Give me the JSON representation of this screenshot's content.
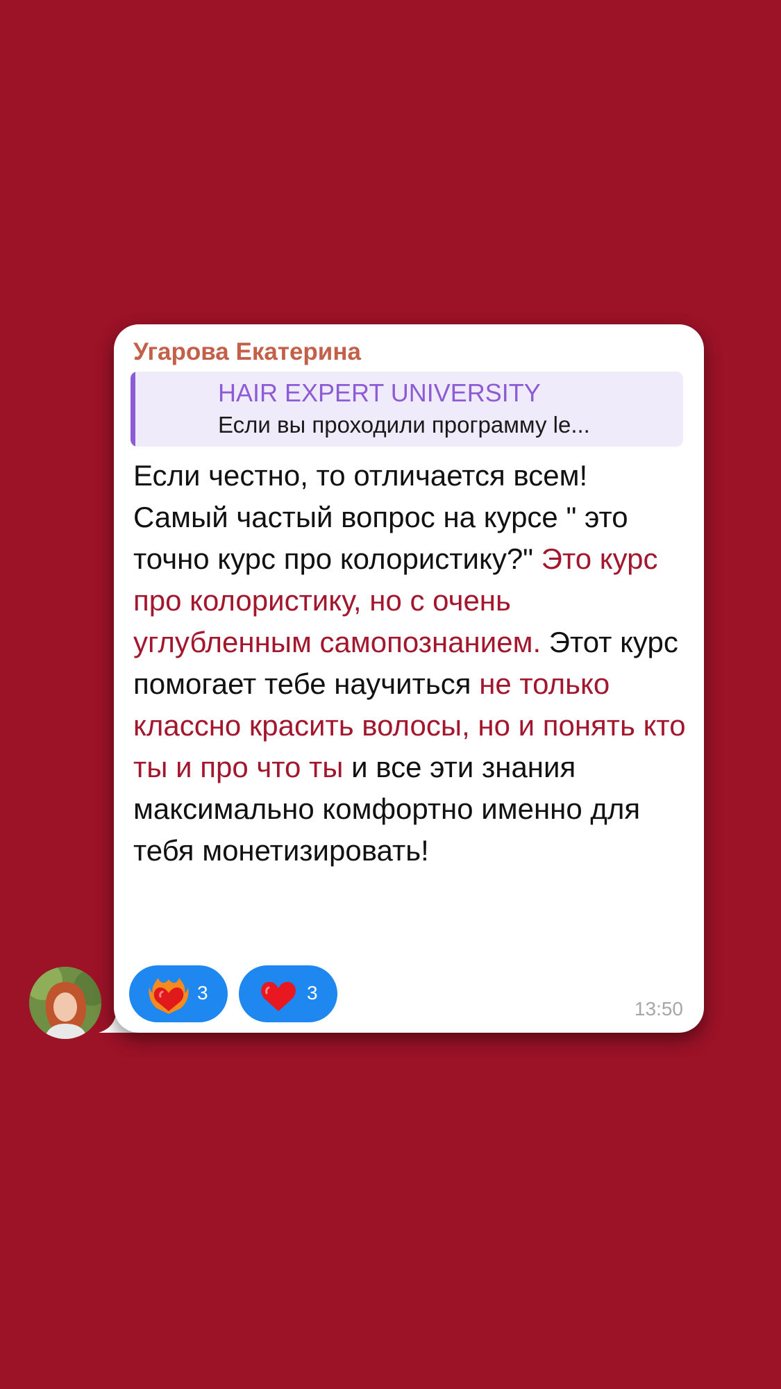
{
  "message": {
    "sender": "Угарова Екатерина",
    "reply": {
      "title": "HAIR EXPERT UNIVERSITY",
      "text": "Если вы проходили программу le..."
    },
    "text": {
      "part1": "Если честно, то отличается всем! Самый частый вопрос на курсе \" это точно курс про колористику?\" ",
      "highlight1": "Это курс про колористику, но с очень углубленным самопознанием.",
      "part2": " Этот курс помогает тебе научиться ",
      "highlight2": "не только классно красить волосы, но и понять кто ты и про что ты",
      "part3": " и все эти знания максимально комфортно именно для тебя монетизировать!"
    },
    "reactions": [
      {
        "icon": "heart-on-fire-icon",
        "count": "3"
      },
      {
        "icon": "red-heart-icon",
        "count": "3"
      }
    ],
    "time": "13:50"
  },
  "colors": {
    "background": "#9c1227",
    "sender_name": "#c2604a",
    "reply_accent": "#8e5bd6",
    "highlight_text": "#a2172e",
    "reaction_pill": "#1e87f0"
  }
}
